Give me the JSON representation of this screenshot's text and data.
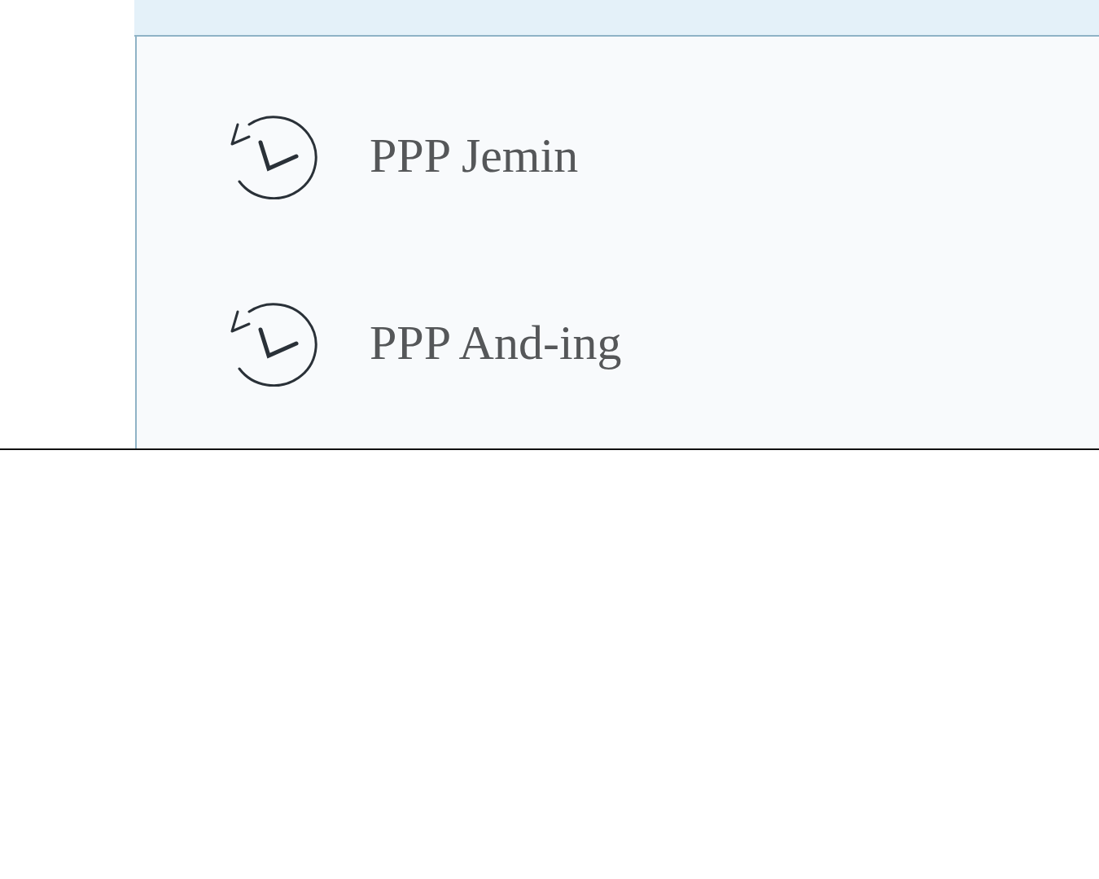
{
  "history": [
    {
      "label": "PPP Jemin"
    },
    {
      "label": "PPP And-ing"
    }
  ]
}
